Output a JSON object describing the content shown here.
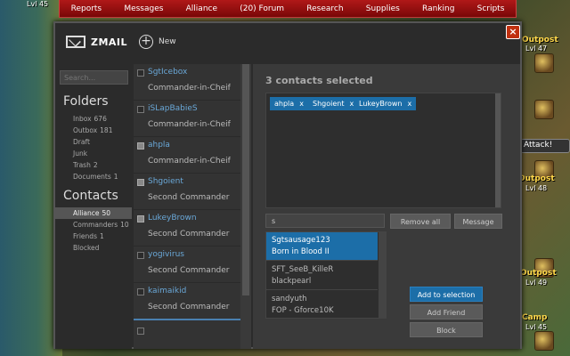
{
  "game": {
    "nav": [
      "Reports",
      "Messages",
      "Alliance",
      "(20) Forum",
      "Research",
      "Supplies",
      "Ranking",
      "Scripts"
    ],
    "map_labels": {
      "lvl_top_left": "Lvl 45",
      "outposts": [
        {
          "name": "Outpost",
          "level": "Lvl 47"
        },
        {
          "name": "Outpost",
          "level": "Lvl 48"
        },
        {
          "name": "Outpost",
          "level": "Lvl 49"
        },
        {
          "name": "Camp",
          "level": "Lvl 45"
        }
      ],
      "attack": "Attack!"
    }
  },
  "zmail": {
    "title": "ZMAIL",
    "new_label": "New",
    "close_label": "×",
    "search_placeholder": "Search...",
    "folders_title": "Folders",
    "folders": [
      {
        "label": "Inbox",
        "count": "676"
      },
      {
        "label": "Outbox",
        "count": "181"
      },
      {
        "label": "Draft",
        "count": ""
      },
      {
        "label": "Junk",
        "count": ""
      },
      {
        "label": "Trash",
        "count": "2"
      },
      {
        "label": "Documents",
        "count": "1"
      }
    ],
    "contacts_title": "Contacts",
    "contact_groups": [
      {
        "label": "Alliance",
        "count": "50",
        "active": true
      },
      {
        "label": "Commanders",
        "count": "10",
        "active": false
      },
      {
        "label": "Friends",
        "count": "1",
        "active": false
      },
      {
        "label": "Blocked",
        "count": "",
        "active": false
      }
    ],
    "contacts": [
      {
        "name": "SgtIcebox",
        "role": "Commander-in-Cheif",
        "checked": false
      },
      {
        "name": "iSLapBabieS",
        "role": "Commander-in-Cheif",
        "checked": false
      },
      {
        "name": "ahpla",
        "role": "Commander-in-Cheif",
        "checked": true
      },
      {
        "name": "Shgoient",
        "role": "Second Commander",
        "checked": true
      },
      {
        "name": "LukeyBrown",
        "role": "Second Commander",
        "checked": true
      },
      {
        "name": "yogivirus",
        "role": "Second Commander",
        "checked": false
      },
      {
        "name": "kaimaikid",
        "role": "Second Commander",
        "checked": false
      }
    ],
    "selected_title": "3 contacts selected",
    "selected_tags": [
      "ahpla",
      "Shgoient",
      "LukeyBrown"
    ],
    "tag_remove": "x",
    "filter_value": "s",
    "remove_all_label": "Remove all",
    "message_label": "Message",
    "results": [
      {
        "line1": "Sgtsausage123",
        "line2": "Born in Blood II",
        "selected": true
      },
      {
        "line1": "SFT_SeeB_KilleR",
        "line2": "blackpearl",
        "selected": false
      },
      {
        "line1": "sandyuth",
        "line2": "FOP - Gforce10K",
        "selected": false
      }
    ],
    "add_to_selection_label": "Add to selection",
    "add_friend_label": "Add Friend",
    "block_label": "Block"
  }
}
